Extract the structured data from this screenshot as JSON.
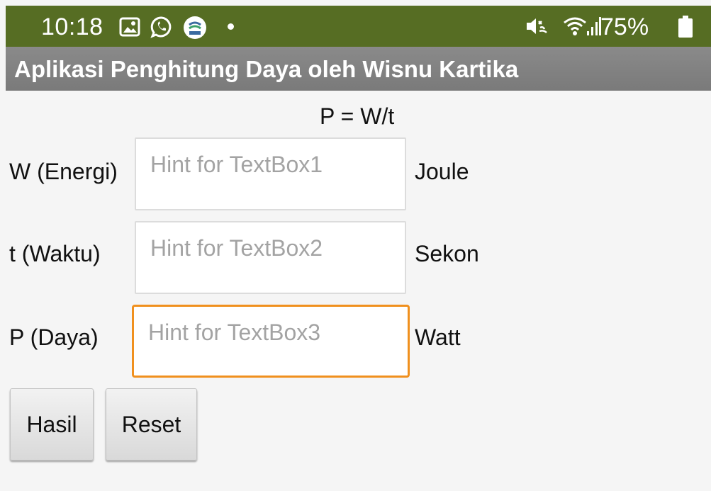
{
  "status_bar": {
    "time": "10:18",
    "battery": "75%",
    "icons": [
      "gallery-icon",
      "whatsapp-icon",
      "bmkg-icon",
      "dot-icon",
      "mute-icon",
      "wifi-icon",
      "signal-icon",
      "battery-icon"
    ],
    "color": "#566d23"
  },
  "app_bar": {
    "title": "Aplikasi Penghitung Daya oleh Wisnu Kartika",
    "color": "#808080"
  },
  "form": {
    "formula": "P = W/t",
    "rows": [
      {
        "label": "W (Energi)",
        "hint": "Hint for TextBox1",
        "value": "",
        "unit": "Joule"
      },
      {
        "label": "t (Waktu)",
        "hint": "Hint for TextBox2",
        "value": "",
        "unit": "Sekon"
      },
      {
        "label": "P (Daya)",
        "hint": "Hint for TextBox3",
        "value": "",
        "unit": "Watt",
        "focused": true
      }
    ],
    "focus_color": "#f0901e"
  },
  "buttons": {
    "hasil": "Hasil",
    "reset": "Reset"
  }
}
